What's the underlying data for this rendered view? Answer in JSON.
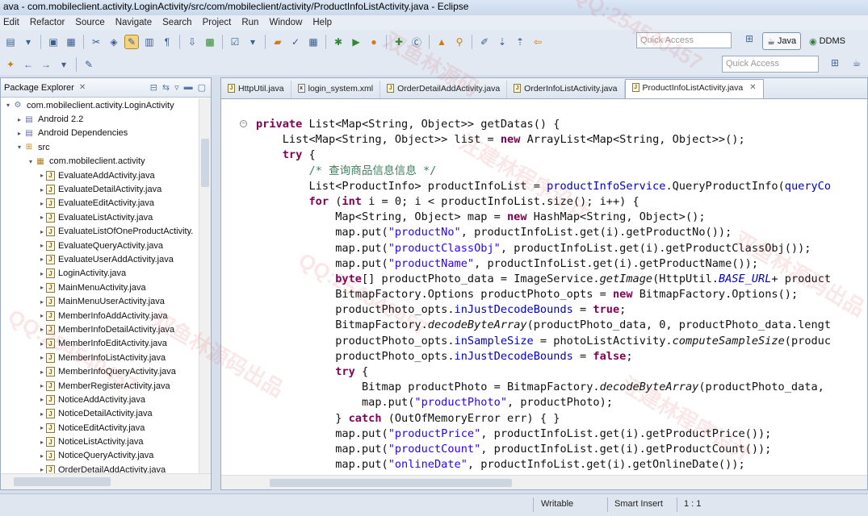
{
  "window": {
    "title": "ava - com.mobileclient.activity.LoginActivity/src/com/mobileclient/activity/ProductInfoListActivity.java - Eclipse"
  },
  "menu": [
    "Edit",
    "Refactor",
    "Source",
    "Navigate",
    "Search",
    "Project",
    "Run",
    "Window",
    "Help"
  ],
  "quick_access": {
    "placeholder_top": "Quick Access",
    "placeholder_second": "Quick Access"
  },
  "perspectives": {
    "java": "Java",
    "ddms": "DDMS"
  },
  "package_explorer": {
    "title": "Package Explorer",
    "items": [
      {
        "label": "com.mobileclient.activity.LoginActivity",
        "kind": "project",
        "indent": 0,
        "twisty": "▾"
      },
      {
        "label": "Android 2.2",
        "kind": "lib",
        "indent": 1,
        "twisty": "▸"
      },
      {
        "label": "Android Dependencies",
        "kind": "lib",
        "indent": 1,
        "twisty": "▸"
      },
      {
        "label": "src",
        "kind": "src",
        "indent": 1,
        "twisty": "▾"
      },
      {
        "label": "com.mobileclient.activity",
        "kind": "package",
        "indent": 2,
        "twisty": "▾"
      },
      {
        "label": "EvaluateAddActivity.java",
        "kind": "java",
        "indent": 3,
        "twisty": "▸"
      },
      {
        "label": "EvaluateDetailActivity.java",
        "kind": "java",
        "indent": 3,
        "twisty": "▸"
      },
      {
        "label": "EvaluateEditActivity.java",
        "kind": "java",
        "indent": 3,
        "twisty": "▸"
      },
      {
        "label": "EvaluateListActivity.java",
        "kind": "java",
        "indent": 3,
        "twisty": "▸"
      },
      {
        "label": "EvaluateListOfOneProductActivity.",
        "kind": "java",
        "indent": 3,
        "twisty": "▸"
      },
      {
        "label": "EvaluateQueryActivity.java",
        "kind": "java",
        "indent": 3,
        "twisty": "▸"
      },
      {
        "label": "EvaluateUserAddActivity.java",
        "kind": "java",
        "indent": 3,
        "twisty": "▸"
      },
      {
        "label": "LoginActivity.java",
        "kind": "java",
        "indent": 3,
        "twisty": "▸"
      },
      {
        "label": "MainMenuActivity.java",
        "kind": "java",
        "indent": 3,
        "twisty": "▸"
      },
      {
        "label": "MainMenuUserActivity.java",
        "kind": "java",
        "indent": 3,
        "twisty": "▸"
      },
      {
        "label": "MemberInfoAddActivity.java",
        "kind": "java",
        "indent": 3,
        "twisty": "▸"
      },
      {
        "label": "MemberInfoDetailActivity.java",
        "kind": "java",
        "indent": 3,
        "twisty": "▸"
      },
      {
        "label": "MemberInfoEditActivity.java",
        "kind": "java",
        "indent": 3,
        "twisty": "▸"
      },
      {
        "label": "MemberInfoListActivity.java",
        "kind": "java",
        "indent": 3,
        "twisty": "▸"
      },
      {
        "label": "MemberInfoQueryActivity.java",
        "kind": "java",
        "indent": 3,
        "twisty": "▸"
      },
      {
        "label": "MemberRegisterActivity.java",
        "kind": "java",
        "indent": 3,
        "twisty": "▸"
      },
      {
        "label": "NoticeAddActivity.java",
        "kind": "java",
        "indent": 3,
        "twisty": "▸"
      },
      {
        "label": "NoticeDetailActivity.java",
        "kind": "java",
        "indent": 3,
        "twisty": "▸"
      },
      {
        "label": "NoticeEditActivity.java",
        "kind": "java",
        "indent": 3,
        "twisty": "▸"
      },
      {
        "label": "NoticeListActivity.java",
        "kind": "java",
        "indent": 3,
        "twisty": "▸"
      },
      {
        "label": "NoticeQueryActivity.java",
        "kind": "java",
        "indent": 3,
        "twisty": "▸"
      },
      {
        "label": "OrderDetailAddActivity.java",
        "kind": "java",
        "indent": 3,
        "twisty": "▸"
      }
    ]
  },
  "editor": {
    "tabs": [
      {
        "label": "HttpUtil.java",
        "kind": "java",
        "active": false
      },
      {
        "label": "login_system.xml",
        "kind": "xml",
        "active": false
      },
      {
        "label": "OrderDetailAddActivity.java",
        "kind": "java",
        "active": false
      },
      {
        "label": "OrderInfoListActivity.java",
        "kind": "java",
        "active": false
      },
      {
        "label": "ProductInfoListActivity.java",
        "kind": "java",
        "active": true
      }
    ],
    "code_lines": [
      [
        [
          "kw",
          "private "
        ],
        [
          "",
          "List<Map<String, Object>> getDatas() {"
        ]
      ],
      [
        [
          "",
          "    List<Map<String, Object>> list = "
        ],
        [
          "kw",
          "new "
        ],
        [
          "",
          "ArrayList<Map<String, Object>>();"
        ]
      ],
      [
        [
          "",
          "    "
        ],
        [
          "kw",
          "try "
        ],
        [
          "",
          "{"
        ]
      ],
      [
        [
          "",
          "        "
        ],
        [
          "cmt",
          "/* 查询商品信息信息 */"
        ]
      ],
      [
        [
          "",
          "        List<ProductInfo> productInfoList = "
        ],
        [
          "fld",
          "productInfoService"
        ],
        [
          "",
          ".QueryProductInfo("
        ],
        [
          "fld",
          "queryCo"
        ]
      ],
      [
        [
          "",
          "        "
        ],
        [
          "kw",
          "for "
        ],
        [
          "",
          "("
        ],
        [
          "kw",
          "int "
        ],
        [
          "",
          "i = 0; i < productInfoList.size(); i++) {"
        ]
      ],
      [
        [
          "",
          "            Map<String, Object> map = "
        ],
        [
          "kw",
          "new "
        ],
        [
          "",
          "HashMap<String, Object>();"
        ]
      ],
      [
        [
          "",
          "            map.put("
        ],
        [
          "str",
          "\"productNo\""
        ],
        [
          "",
          ", productInfoList.get(i).getProductNo());"
        ]
      ],
      [
        [
          "",
          "            map.put("
        ],
        [
          "str",
          "\"productClassObj\""
        ],
        [
          "",
          ", productInfoList.get(i).getProductClassObj());"
        ]
      ],
      [
        [
          "",
          "            map.put("
        ],
        [
          "str",
          "\"productName\""
        ],
        [
          "",
          ", productInfoList.get(i).getProductName());"
        ]
      ],
      [
        [
          "",
          "            "
        ],
        [
          "kw",
          "byte"
        ],
        [
          "",
          "[] productPhoto_data = ImageService."
        ],
        [
          "it",
          "getImage"
        ],
        [
          "",
          "(HttpUtil."
        ],
        [
          "fldit",
          "BASE_URL"
        ],
        [
          "",
          "+ product"
        ]
      ],
      [
        [
          "",
          "            BitmapFactory.Options productPhoto_opts = "
        ],
        [
          "kw",
          "new "
        ],
        [
          "",
          "BitmapFactory.Options();"
        ]
      ],
      [
        [
          "",
          "            productPhoto_opts."
        ],
        [
          "fld",
          "inJustDecodeBounds"
        ],
        [
          "",
          " = "
        ],
        [
          "kw",
          "true"
        ],
        [
          "",
          ";"
        ]
      ],
      [
        [
          "",
          "            BitmapFactory."
        ],
        [
          "it",
          "decodeByteArray"
        ],
        [
          "",
          "(productPhoto_data, 0, productPhoto_data.lengt"
        ]
      ],
      [
        [
          "",
          "            productPhoto_opts."
        ],
        [
          "fld",
          "inSampleSize"
        ],
        [
          "",
          " = photoListActivity."
        ],
        [
          "it",
          "computeSampleSize"
        ],
        [
          "",
          "(produc"
        ]
      ],
      [
        [
          "",
          "            productPhoto_opts."
        ],
        [
          "fld",
          "inJustDecodeBounds"
        ],
        [
          "",
          " = "
        ],
        [
          "kw",
          "false"
        ],
        [
          "",
          ";"
        ]
      ],
      [
        [
          "",
          "            "
        ],
        [
          "kw",
          "try "
        ],
        [
          "",
          "{"
        ]
      ],
      [
        [
          "",
          "                Bitmap productPhoto = BitmapFactory."
        ],
        [
          "it",
          "decodeByteArray"
        ],
        [
          "",
          "(productPhoto_data,"
        ]
      ],
      [
        [
          "",
          "                map.put("
        ],
        [
          "str",
          "\"productPhoto\""
        ],
        [
          "",
          ", productPhoto);"
        ]
      ],
      [
        [
          "",
          "            } "
        ],
        [
          "kw",
          "catch "
        ],
        [
          "",
          "(OutOfMemoryError err) { }"
        ]
      ],
      [
        [
          "",
          "            map.put("
        ],
        [
          "str",
          "\"productPrice\""
        ],
        [
          "",
          ", productInfoList.get(i).getProductPrice());"
        ]
      ],
      [
        [
          "",
          "            map.put("
        ],
        [
          "str",
          "\"productCount\""
        ],
        [
          "",
          ", productInfoList.get(i).getProductCount());"
        ]
      ],
      [
        [
          "",
          "            map.put("
        ],
        [
          "str",
          "\"onlineDate\""
        ],
        [
          "",
          ", productInfoList.get(i).getOnlineDate());"
        ]
      ]
    ]
  },
  "status_bar": {
    "writable": "Writable",
    "insert_mode": "Smart Insert",
    "position": "1 : 1"
  },
  "watermarks": [
    "QQ:254540457",
    "双鱼林源码",
    "汪建林程序设计",
    "双鱼林源码出品",
    "QQ:254540457",
    "汪建林程序设计",
    "双鱼林源码出品",
    "QQ:254540457"
  ]
}
